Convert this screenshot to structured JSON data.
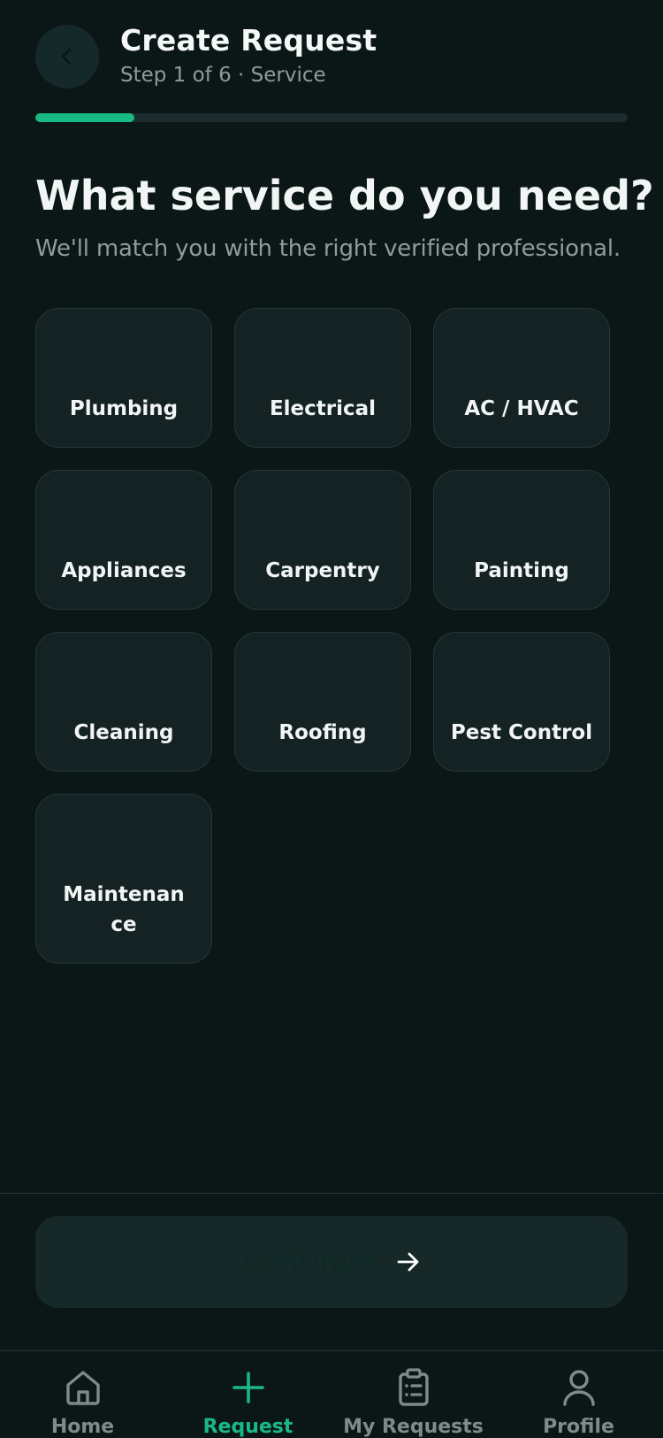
{
  "header": {
    "title": "Create Request",
    "subtitle": "Step 1 of 6 · Service",
    "progress": 0.1667
  },
  "main": {
    "question": "What service do you need?",
    "subtitle": "We'll match you with the right verified professional."
  },
  "services": [
    {
      "label": "Plumbing"
    },
    {
      "label": "Electrical"
    },
    {
      "label": "AC / HVAC"
    },
    {
      "label": "Appliances"
    },
    {
      "label": "Carpentry"
    },
    {
      "label": "Painting"
    },
    {
      "label": "Cleaning"
    },
    {
      "label": "Roofing"
    },
    {
      "label": "Pest Control"
    },
    {
      "label": "Maintenance"
    }
  ],
  "footer": {
    "continue_label": "Continue",
    "continue_icon": "arrow-right-icon"
  },
  "nav": {
    "items": [
      {
        "label": "Home",
        "icon": "home-icon"
      },
      {
        "label": "Request",
        "icon": "plus-icon",
        "active": true
      },
      {
        "label": "My Requests",
        "icon": "clipboard-icon"
      },
      {
        "label": "Profile",
        "icon": "user-icon"
      }
    ]
  },
  "colors": {
    "background": "#0b1617",
    "accent": "#19b984",
    "tile": "#142223",
    "muted_text": "#8e9c9a"
  }
}
